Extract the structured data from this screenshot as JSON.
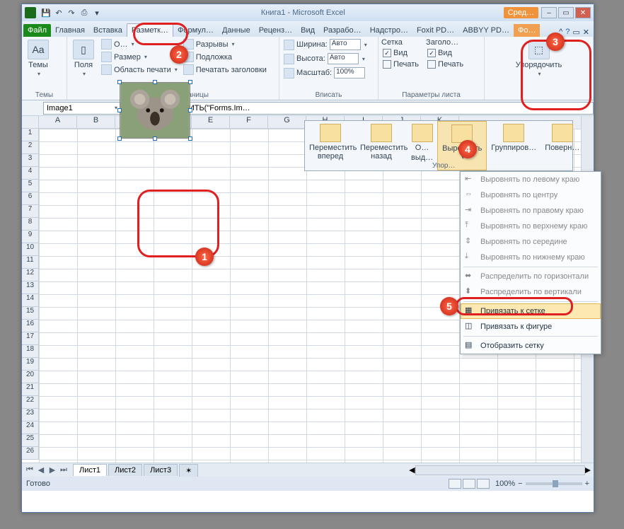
{
  "title": {
    "doc": "Книга1",
    "app": "Microsoft Excel",
    "tool": "Сред…"
  },
  "qat_icons": [
    "excel",
    "save",
    "undo",
    "redo",
    "print",
    "open"
  ],
  "tabs": {
    "file": "Файл",
    "items": [
      "Главная",
      "Вставка",
      "Разметк…",
      "Формул…",
      "Данные",
      "Реценз…",
      "Вид",
      "Разрабо…",
      "Надстро…",
      "Foxit PD…",
      "ABBYY PD…"
    ],
    "format": "Фо…",
    "active_index": 2
  },
  "ribbon": {
    "themes": {
      "btn": "Темы",
      "label": "Темы"
    },
    "page_setup": {
      "margins": "Поля",
      "orientation": "О…",
      "size": "Размер",
      "print_area": "Область печати",
      "breaks": "Разрывы",
      "background": "Подложка",
      "titles": "Печатать заголовки",
      "label": "Параметры страницы"
    },
    "scale": {
      "width_lbl": "Ширина:",
      "width_val": "Авто",
      "height_lbl": "Высота:",
      "height_val": "Авто",
      "scale_lbl": "Масштаб:",
      "scale_val": "100%",
      "label": "Вписать"
    },
    "sheet_opts": {
      "grid": "Сетка",
      "headings": "Заголо…",
      "view": "Вид",
      "print": "Печать",
      "label": "Параметры листа"
    },
    "arrange": {
      "btn": "Упорядочить"
    }
  },
  "fx": {
    "name": "Image1",
    "formula": "=ВНЕДРИТЬ(\"Forms.Im…"
  },
  "cols": [
    "A",
    "B",
    "C",
    "D",
    "E",
    "F",
    "G",
    "H",
    "I",
    "J",
    "K"
  ],
  "rows": [
    "1",
    "2",
    "3",
    "4",
    "5",
    "6",
    "7",
    "8",
    "9",
    "10",
    "11",
    "12",
    "13",
    "14",
    "15",
    "16",
    "17",
    "18",
    "19",
    "20",
    "21",
    "22",
    "23",
    "24",
    "25",
    "26"
  ],
  "popup": {
    "forward": "Переместить вперед",
    "back": "Переместить назад",
    "selpane_a": "О…",
    "selpane_b": "выд…",
    "align": "Выровнять",
    "group": "Группиров…",
    "rotate": "Поверн…",
    "label": "Упор…"
  },
  "menu": {
    "left": "Выровнять по левому краю",
    "center": "Выровнять по центру",
    "right": "Выровнять по правому краю",
    "top": "Выровнять по верхнему краю",
    "middle": "Выровнять по середине",
    "bottom": "Выровнять по нижнему краю",
    "dist_h": "Распределить по горизонтали",
    "dist_v": "Распределить по вертикали",
    "snap_grid": "Привязать к сетке",
    "snap_shape": "Привязать к фигуре",
    "show_grid": "Отобразить сетку"
  },
  "sheets": {
    "s1": "Лист1",
    "s2": "Лист2",
    "s3": "Лист3"
  },
  "status": {
    "ready": "Готово",
    "zoom": "100%"
  },
  "callouts": {
    "n1": "1",
    "n2": "2",
    "n3": "3",
    "n4": "4",
    "n5": "5"
  }
}
